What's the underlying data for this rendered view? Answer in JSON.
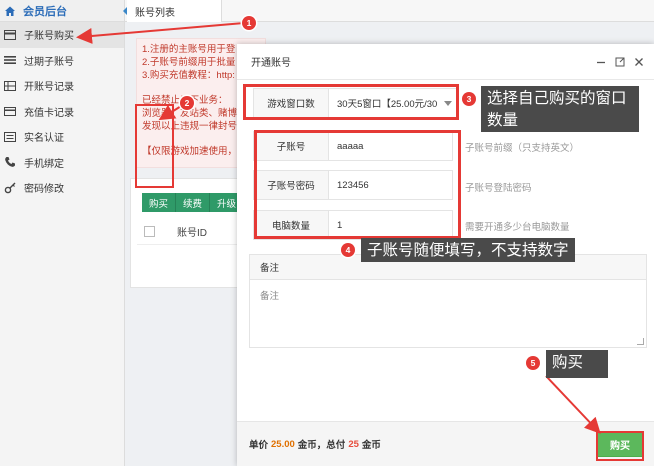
{
  "sidebar": {
    "header": "会员后台",
    "items": [
      {
        "label": "子账号购买",
        "icon": "card-icon",
        "active": true
      },
      {
        "label": "过期子账号",
        "icon": "list-icon"
      },
      {
        "label": "开账号记录",
        "icon": "grid-icon"
      },
      {
        "label": "充值卡记录",
        "icon": "card-stack-icon"
      },
      {
        "label": "实名认证",
        "icon": "id-card-icon"
      },
      {
        "label": "手机绑定",
        "icon": "phone-icon"
      },
      {
        "label": "密码修改",
        "icon": "key-icon"
      }
    ]
  },
  "main": {
    "tab_label": "账号列表",
    "notice_lines": [
      "1.注册的主账号用于登",
      "2.子账号前缀用于批量",
      "3.购买充值教程：http:",
      "",
      "已经禁止以下业务：",
      "浏览器、友站类、赌博",
      "发现以上违规一律封号",
      "",
      "【仅限游戏加速使用，"
    ],
    "buttons": [
      "购买",
      "续费",
      "升级"
    ],
    "table_header": "账号ID"
  },
  "modal": {
    "title": "开通账号",
    "window_count_label": "游戏窗口数",
    "window_count_value": "30天5窗口【25.00元/30",
    "sub_account_label": "子账号",
    "sub_account_value": "aaaaa",
    "sub_account_hint": "子账号前缀（只支持英文）",
    "password_label": "子账号密码",
    "password_value": "123456",
    "password_hint": "子账号登陆密码",
    "pc_count_label": "电脑数量",
    "pc_count_value": "1",
    "pc_count_hint": "需要开通多少台电脑数量",
    "remark_label": "备注",
    "remark_placeholder": "备注",
    "footer_unit_label": "单价",
    "footer_unit_price": "25.00",
    "footer_coin": "金币，总付",
    "footer_total": "25",
    "footer_coin2": "金币",
    "buy_label": "购买"
  },
  "annotations": {
    "badges": [
      "1",
      "2",
      "3",
      "4",
      "5"
    ],
    "callout3": "选择自己购买的窗口数量",
    "callout4": "子账号随便填写，不支持数字",
    "callout5": "购买"
  },
  "colors": {
    "annotation_red": "#e53935",
    "callout_bg": "#4a4a4a",
    "buy_green": "#5cb85c",
    "action_green": "#2f9a68",
    "link_blue": "#2b6cb8"
  }
}
